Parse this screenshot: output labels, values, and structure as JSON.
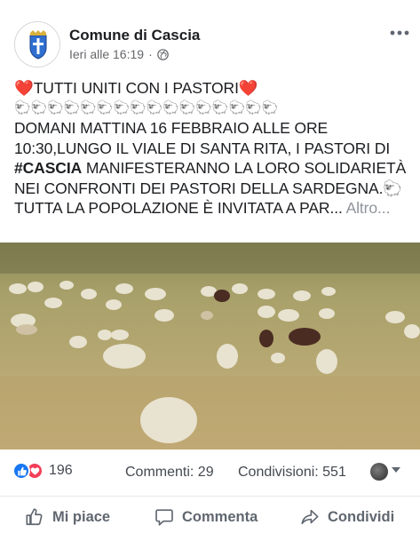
{
  "post": {
    "page_name": "Comune di Cascia",
    "timestamp": "Ieri alle 16:19",
    "separator": "·",
    "more_icon": "more-icon",
    "text": {
      "line1": "❤️TUTTI UNITI CON I PASTORI❤️",
      "line2": "🐑🐑🐑🐑🐑🐑🐑🐑🐑🐑🐑🐑🐑🐑🐑🐑",
      "line3": "DOMANI  MATTINA  16 FEBBRAIO ALLE ORE",
      "line4": "10:30,LUNGO IL VIALE DI SANTA RITA, I PASTORI DI",
      "line5_hashtag": "#CASCIA",
      "line5_rest": " MANIFESTERANNO LA LORO SOLIDARIETÀ",
      "line6": "NEI CONFRONTI DEI PASTORI DELLA SARDEGNA.🐑",
      "line7": "TUTTA LA POPOLAZIONE È INVITATA A PAR...",
      "see_more": "Altro..."
    }
  },
  "stats": {
    "reaction_count": "196",
    "comments": "Commenti: 29",
    "shares": "Condivisioni: 551"
  },
  "actions": {
    "like": "Mi piace",
    "comment": "Commenta",
    "share": "Condividi"
  },
  "colors": {
    "like_blue": "#1877f2",
    "love_red": "#f33e58",
    "secondary_text": "#65676b"
  }
}
